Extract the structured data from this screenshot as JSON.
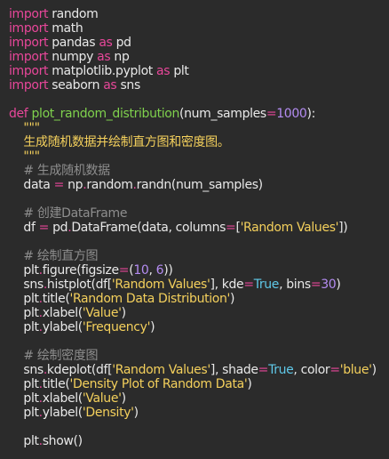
{
  "editor": {
    "lines": [
      [
        {
          "t": "import",
          "c": "kw"
        },
        {
          "t": " random",
          "c": "plain"
        }
      ],
      [
        {
          "t": "import",
          "c": "kw"
        },
        {
          "t": " math",
          "c": "plain"
        }
      ],
      [
        {
          "t": "import",
          "c": "kw"
        },
        {
          "t": " pandas ",
          "c": "plain"
        },
        {
          "t": "as",
          "c": "kw"
        },
        {
          "t": " pd",
          "c": "plain"
        }
      ],
      [
        {
          "t": "import",
          "c": "kw"
        },
        {
          "t": " numpy ",
          "c": "plain"
        },
        {
          "t": "as",
          "c": "kw"
        },
        {
          "t": " np",
          "c": "plain"
        }
      ],
      [
        {
          "t": "import",
          "c": "kw"
        },
        {
          "t": " matplotlib.pyplot ",
          "c": "plain"
        },
        {
          "t": "as",
          "c": "kw"
        },
        {
          "t": " plt",
          "c": "plain"
        }
      ],
      [
        {
          "t": "import",
          "c": "kw"
        },
        {
          "t": " seaborn ",
          "c": "plain"
        },
        {
          "t": "as",
          "c": "kw"
        },
        {
          "t": " sns",
          "c": "plain"
        }
      ],
      [],
      [
        {
          "t": "def",
          "c": "kw"
        },
        {
          "t": " ",
          "c": "plain"
        },
        {
          "t": "plot_random_distribution",
          "c": "fn"
        },
        {
          "t": "(num_samples",
          "c": "plain"
        },
        {
          "t": "=",
          "c": "op"
        },
        {
          "t": "1000",
          "c": "num"
        },
        {
          "t": "):",
          "c": "plain"
        }
      ],
      [
        {
          "t": "    \"\"\"",
          "c": "doc"
        }
      ],
      [
        {
          "t": "    生成随机数据并绘制直方图和密度图。",
          "c": "doc"
        }
      ],
      [
        {
          "t": "    \"\"\"",
          "c": "doc"
        }
      ],
      [
        {
          "t": "    # 生成随机数据",
          "c": "cm"
        }
      ],
      [
        {
          "t": "    data ",
          "c": "plain"
        },
        {
          "t": "=",
          "c": "op"
        },
        {
          "t": " np",
          "c": "plain"
        },
        {
          "t": ".",
          "c": "op"
        },
        {
          "t": "random",
          "c": "plain"
        },
        {
          "t": ".",
          "c": "op"
        },
        {
          "t": "randn(num_samples)",
          "c": "plain"
        }
      ],
      [],
      [
        {
          "t": "    # 创建DataFrame",
          "c": "cm"
        }
      ],
      [
        {
          "t": "    df ",
          "c": "plain"
        },
        {
          "t": "=",
          "c": "op"
        },
        {
          "t": " pd",
          "c": "plain"
        },
        {
          "t": ".",
          "c": "op"
        },
        {
          "t": "DataFrame(data, columns",
          "c": "plain"
        },
        {
          "t": "=",
          "c": "op"
        },
        {
          "t": "[",
          "c": "plain"
        },
        {
          "t": "'Random Values'",
          "c": "str"
        },
        {
          "t": "])",
          "c": "plain"
        }
      ],
      [],
      [
        {
          "t": "    # 绘制直方图",
          "c": "cm"
        }
      ],
      [
        {
          "t": "    plt",
          "c": "plain"
        },
        {
          "t": ".",
          "c": "op"
        },
        {
          "t": "figure(figsize",
          "c": "plain"
        },
        {
          "t": "=",
          "c": "op"
        },
        {
          "t": "(",
          "c": "plain"
        },
        {
          "t": "10",
          "c": "num"
        },
        {
          "t": ", ",
          "c": "plain"
        },
        {
          "t": "6",
          "c": "num"
        },
        {
          "t": "))",
          "c": "plain"
        }
      ],
      [
        {
          "t": "    sns",
          "c": "plain"
        },
        {
          "t": ".",
          "c": "op"
        },
        {
          "t": "histplot(df[",
          "c": "plain"
        },
        {
          "t": "'Random Values'",
          "c": "str"
        },
        {
          "t": "], kde",
          "c": "plain"
        },
        {
          "t": "=",
          "c": "op"
        },
        {
          "t": "True",
          "c": "bool"
        },
        {
          "t": ", bins",
          "c": "plain"
        },
        {
          "t": "=",
          "c": "op"
        },
        {
          "t": "30",
          "c": "num"
        },
        {
          "t": ")",
          "c": "plain"
        }
      ],
      [
        {
          "t": "    plt",
          "c": "plain"
        },
        {
          "t": ".",
          "c": "op"
        },
        {
          "t": "title(",
          "c": "plain"
        },
        {
          "t": "'Random Data Distribution'",
          "c": "str"
        },
        {
          "t": ")",
          "c": "plain"
        }
      ],
      [
        {
          "t": "    plt",
          "c": "plain"
        },
        {
          "t": ".",
          "c": "op"
        },
        {
          "t": "xlabel(",
          "c": "plain"
        },
        {
          "t": "'Value'",
          "c": "str"
        },
        {
          "t": ")",
          "c": "plain"
        }
      ],
      [
        {
          "t": "    plt",
          "c": "plain"
        },
        {
          "t": ".",
          "c": "op"
        },
        {
          "t": "ylabel(",
          "c": "plain"
        },
        {
          "t": "'Frequency'",
          "c": "str"
        },
        {
          "t": ")",
          "c": "plain"
        }
      ],
      [],
      [
        {
          "t": "    # 绘制密度图",
          "c": "cm"
        }
      ],
      [
        {
          "t": "    sns",
          "c": "plain"
        },
        {
          "t": ".",
          "c": "op"
        },
        {
          "t": "kdeplot(df[",
          "c": "plain"
        },
        {
          "t": "'Random Values'",
          "c": "str"
        },
        {
          "t": "], shade",
          "c": "plain"
        },
        {
          "t": "=",
          "c": "op"
        },
        {
          "t": "True",
          "c": "bool"
        },
        {
          "t": ", color",
          "c": "plain"
        },
        {
          "t": "=",
          "c": "op"
        },
        {
          "t": "'blue'",
          "c": "str"
        },
        {
          "t": ")",
          "c": "plain"
        }
      ],
      [
        {
          "t": "    plt",
          "c": "plain"
        },
        {
          "t": ".",
          "c": "op"
        },
        {
          "t": "title(",
          "c": "plain"
        },
        {
          "t": "'Density Plot of Random Data'",
          "c": "str"
        },
        {
          "t": ")",
          "c": "plain"
        }
      ],
      [
        {
          "t": "    plt",
          "c": "plain"
        },
        {
          "t": ".",
          "c": "op"
        },
        {
          "t": "xlabel(",
          "c": "plain"
        },
        {
          "t": "'Value'",
          "c": "str"
        },
        {
          "t": ")",
          "c": "plain"
        }
      ],
      [
        {
          "t": "    plt",
          "c": "plain"
        },
        {
          "t": ".",
          "c": "op"
        },
        {
          "t": "ylabel(",
          "c": "plain"
        },
        {
          "t": "'Density'",
          "c": "str"
        },
        {
          "t": ")",
          "c": "plain"
        }
      ],
      [],
      [
        {
          "t": "    plt",
          "c": "plain"
        },
        {
          "t": ".",
          "c": "op"
        },
        {
          "t": "show()",
          "c": "plain"
        }
      ]
    ]
  },
  "colors": {
    "background": "#2b2b2b",
    "keyword": "#e8479a",
    "function": "#7fd14d",
    "string": "#f4d05c",
    "number": "#b48cf2",
    "comment": "#8e8e8e",
    "bool": "#5fc8e8",
    "text": "#e8e8e8"
  }
}
